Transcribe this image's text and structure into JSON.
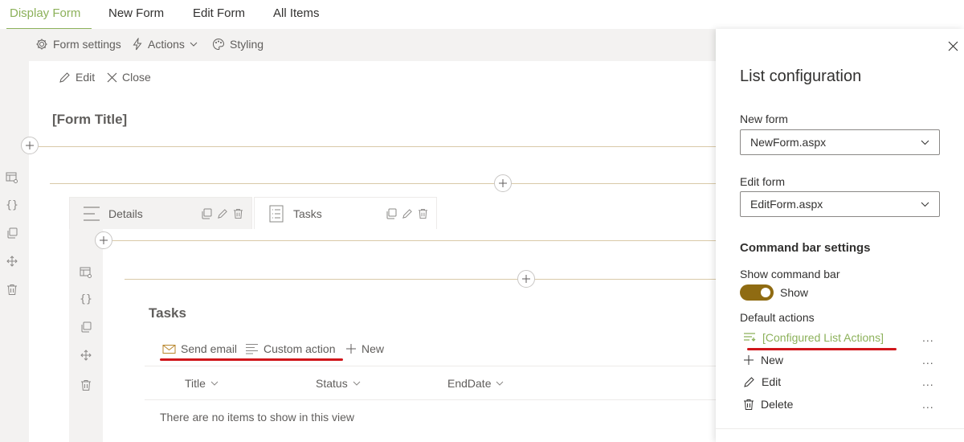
{
  "tabs": [
    {
      "label": "Display Form",
      "active": true
    },
    {
      "label": "New Form",
      "active": false
    },
    {
      "label": "Edit Form",
      "active": false
    },
    {
      "label": "All Items",
      "active": false
    }
  ],
  "toolbar": {
    "form_settings": "Form settings",
    "actions": "Actions",
    "styling": "Styling"
  },
  "form_commands": {
    "edit": "Edit",
    "close": "Close"
  },
  "form_title": "[Form Title]",
  "container_tabs": [
    {
      "label": "Details"
    },
    {
      "label": "Tasks"
    }
  ],
  "tasks": {
    "title": "Tasks",
    "commands": {
      "send_email": "Send email",
      "custom_action": "Custom action",
      "new": "New"
    },
    "columns": [
      "Title",
      "Status",
      "EndDate"
    ],
    "empty_message": "There are no items to show in this view"
  },
  "panel": {
    "title": "List configuration",
    "new_form_label": "New form",
    "new_form_value": "NewForm.aspx",
    "edit_form_label": "Edit form",
    "edit_form_value": "EditForm.aspx",
    "command_bar_heading": "Command bar settings",
    "show_command_bar_label": "Show command bar",
    "show_toggle_text": "Show",
    "show_toggle_on": true,
    "default_actions_label": "Default actions",
    "actions": [
      {
        "label": "[Configured List Actions]",
        "icon": "configured-list-icon"
      },
      {
        "label": "New",
        "icon": "plus-icon"
      },
      {
        "label": "Edit",
        "icon": "pencil-icon"
      },
      {
        "label": "Delete",
        "icon": "trash-icon"
      }
    ],
    "more_glyph": "..."
  },
  "colors": {
    "accent_green": "#8cb15a",
    "toggle_gold": "#8f6b12",
    "annotation_red": "#d0161b",
    "rule_tan": "#d9c9a8"
  }
}
